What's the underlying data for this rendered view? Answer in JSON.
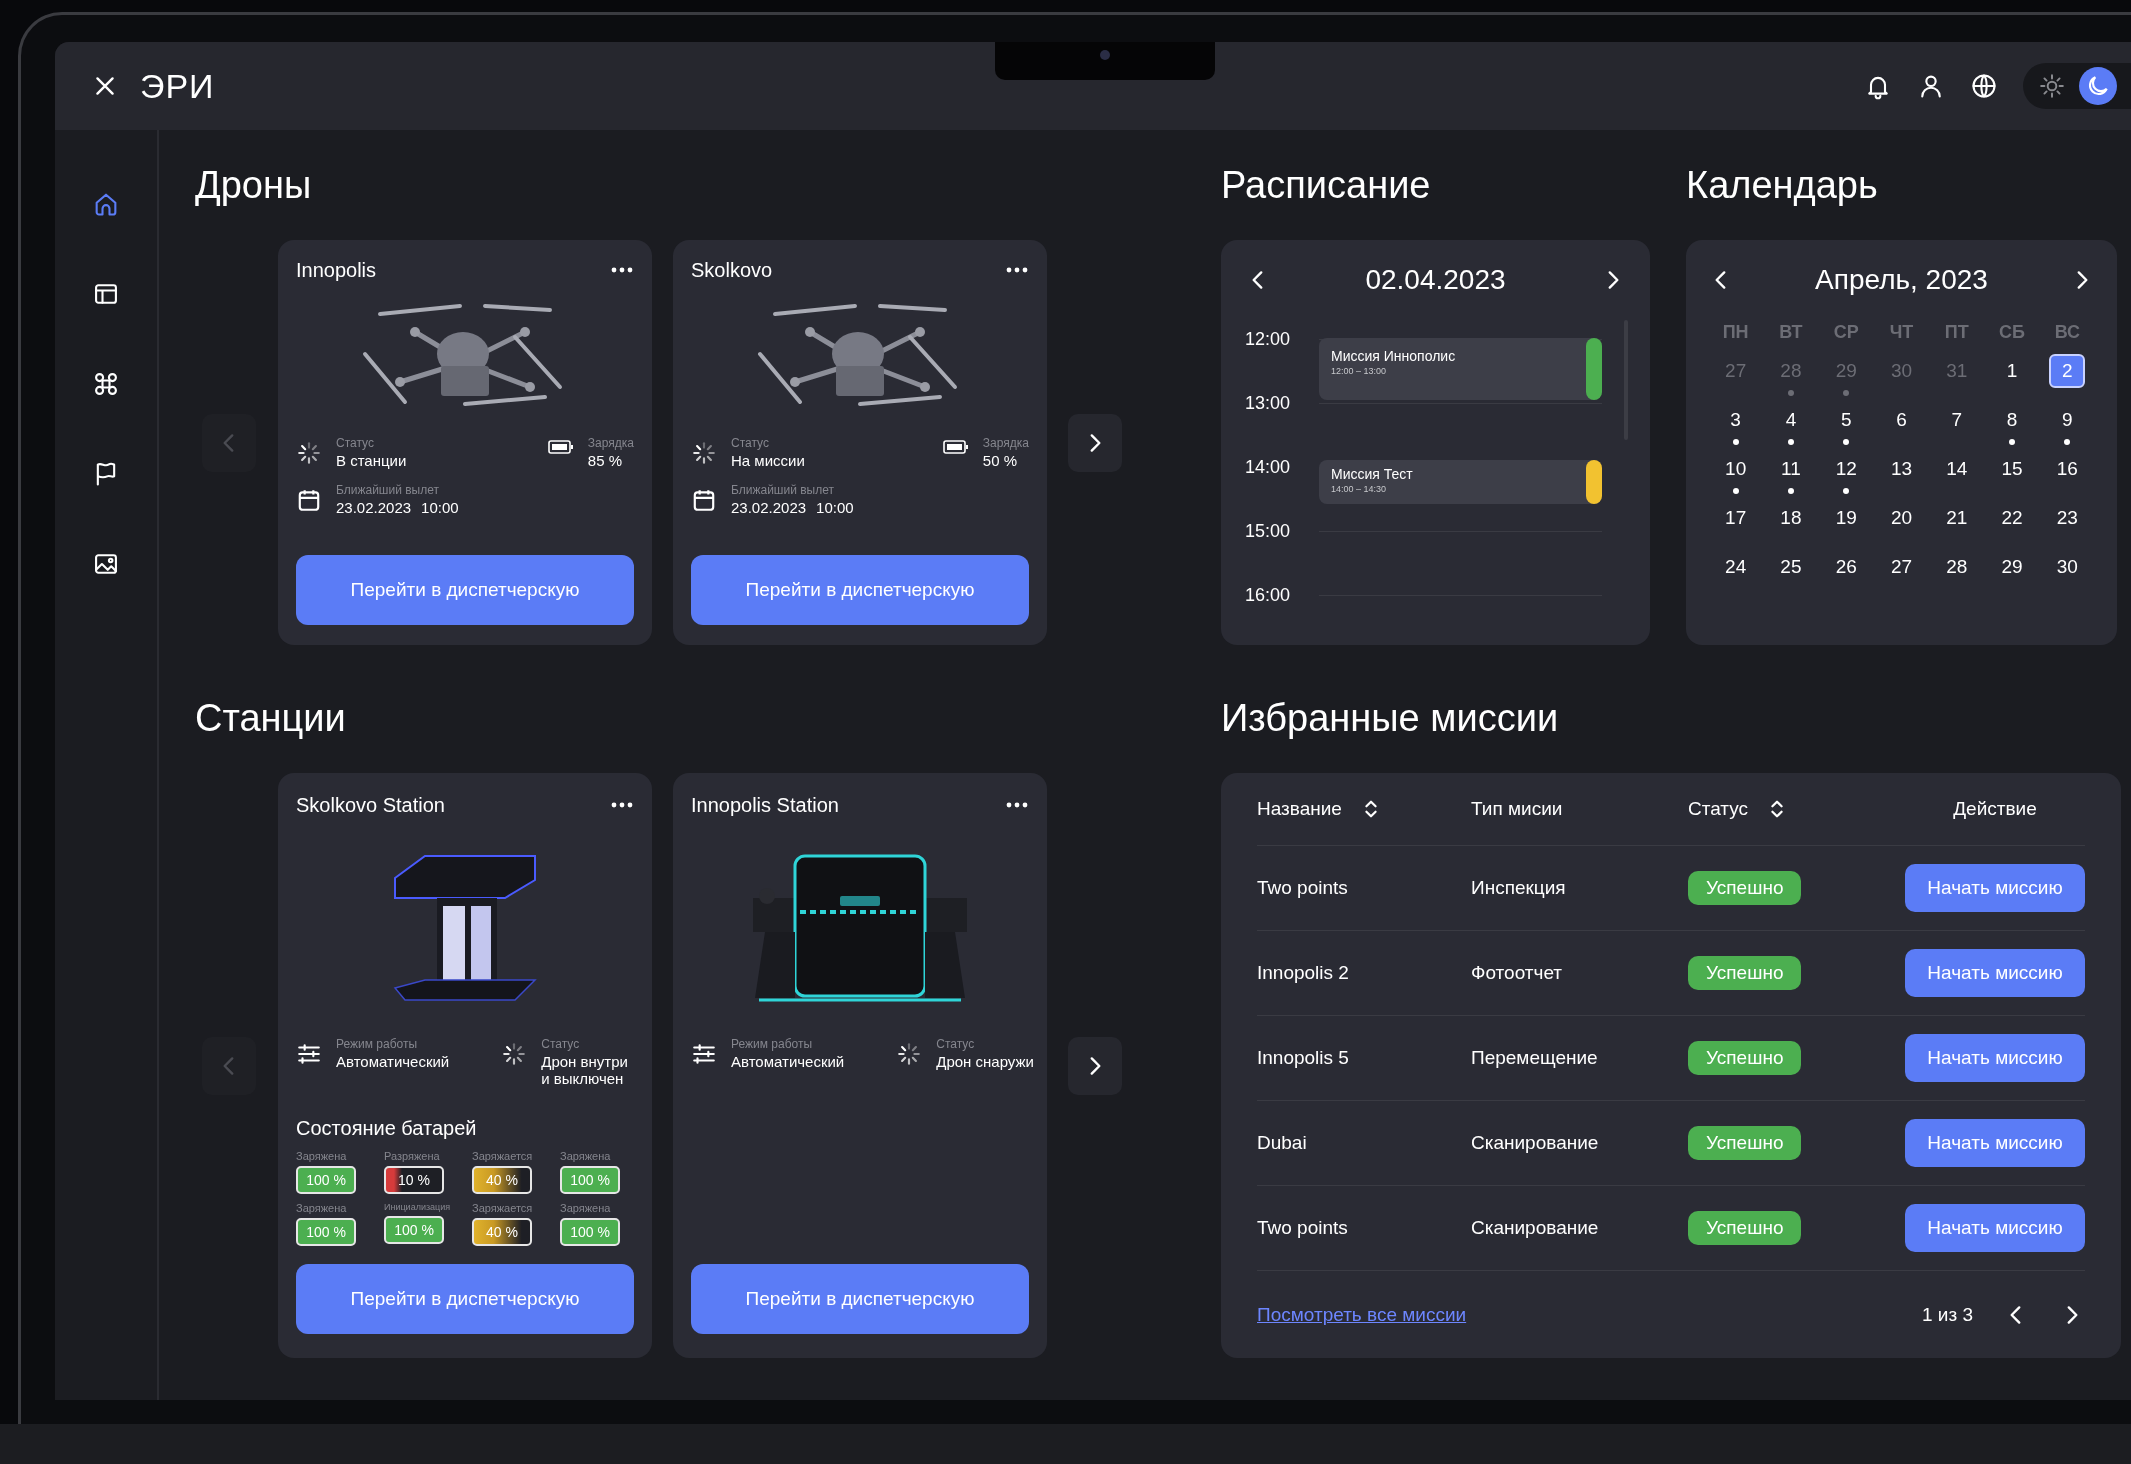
{
  "header": {
    "logo": "ЭРИ",
    "icons": [
      {
        "kind": "bell"
      },
      {
        "kind": "user"
      },
      {
        "kind": "globe"
      }
    ],
    "theme_toggle": {
      "dark": true
    }
  },
  "sidebar": {
    "items": [
      {
        "kind": "home",
        "selected": true
      },
      {
        "kind": "panel",
        "selected": false
      },
      {
        "kind": "drone",
        "selected": false
      },
      {
        "kind": "flag",
        "selected": false
      },
      {
        "kind": "image",
        "selected": false
      }
    ]
  },
  "drones": {
    "title": "Дроны",
    "prev": {
      "disabled": true
    },
    "next": {
      "disabled": false
    },
    "cards": [
      {
        "name": "Innopolis",
        "status_label": "Статус",
        "status": "В станции",
        "charge_label": "Зарядка",
        "charge": "85 %",
        "departure_label": "Ближайший вылет",
        "departure_date": "23.02.2023",
        "departure_time": "10:00",
        "button": "Перейти в диспетчерскую"
      },
      {
        "name": "Skolkovo",
        "status_label": "Статус",
        "status": "На миссии",
        "charge_label": "Зарядка",
        "charge": "50 %",
        "departure_label": "Ближайший вылет",
        "departure_date": "23.02.2023",
        "departure_time": "10:00",
        "button": "Перейти в диспетчерскую"
      }
    ]
  },
  "stations": {
    "title": "Станции",
    "prev": {
      "disabled": true
    },
    "next": {
      "disabled": false
    },
    "cards": [
      {
        "name": "Skolkovo Station",
        "kind": "pillar",
        "mode_label": "Режим работы",
        "mode": "Автоматический",
        "status_label": "Статус",
        "status": "Дрон внутри\nи выключен",
        "batteries": {
          "title": "Состояние батарей",
          "items": [
            {
              "label": "Заряжена",
              "value": "100 %",
              "kind": "full"
            },
            {
              "label": "Разряжена",
              "value": "10 %",
              "kind": "low"
            },
            {
              "label": "Заряжается",
              "value": "40 %",
              "kind": "charging"
            },
            {
              "label": "Заряжена",
              "value": "100 %",
              "kind": "full"
            },
            {
              "label": "Заряжена",
              "value": "100 %",
              "kind": "full"
            },
            {
              "label": "Инициализация",
              "value": "100 %",
              "kind": "full"
            },
            {
              "label": "Заряжается",
              "value": "40 %",
              "kind": "charging"
            },
            {
              "label": "Заряжена",
              "value": "100 %",
              "kind": "full"
            }
          ]
        },
        "button": "Перейти в диспетчерскую"
      },
      {
        "name": "Innopolis Station",
        "kind": "cabinet",
        "mode_label": "Режим работы",
        "mode": "Автоматический",
        "status_label": "Статус",
        "status": "Дрон снаружи",
        "button": "Перейти в диспетчерскую"
      }
    ]
  },
  "schedule": {
    "title": "Расписание",
    "date": "02.04.2023",
    "hours": [
      {
        "time": "12:00",
        "event": {
          "title": "Миссия Иннополис",
          "time": "12:00 – 13:00",
          "kind": "hour",
          "color": "#4caf50"
        }
      },
      {
        "time": "13:00"
      },
      {
        "time": "14:00",
        "event": {
          "title": "Миссия Тест",
          "time": "14:00 – 14:30",
          "kind": "half",
          "color": "#f2c230"
        }
      },
      {
        "time": "15:00"
      },
      {
        "time": "16:00"
      }
    ]
  },
  "calendar": {
    "title": "Календарь",
    "month": "Апрель, 2023",
    "weekdays": [
      "ПН",
      "ВТ",
      "СР",
      "ЧТ",
      "ПТ",
      "СБ",
      "ВС"
    ],
    "days": [
      {
        "day": "27",
        "muted": true,
        "selected": false,
        "has_event": false
      },
      {
        "day": "28",
        "muted": true,
        "selected": false,
        "has_event": true
      },
      {
        "day": "29",
        "muted": true,
        "selected": false,
        "has_event": true
      },
      {
        "day": "30",
        "muted": true,
        "selected": false,
        "has_event": false
      },
      {
        "day": "31",
        "muted": true,
        "selected": false,
        "has_event": false
      },
      {
        "day": "1",
        "muted": false,
        "selected": false,
        "has_event": false
      },
      {
        "day": "2",
        "muted": false,
        "selected": true,
        "has_event": false
      },
      {
        "day": "3",
        "muted": false,
        "selected": false,
        "has_event": true
      },
      {
        "day": "4",
        "muted": false,
        "selected": false,
        "has_event": true
      },
      {
        "day": "5",
        "muted": false,
        "selected": false,
        "has_event": true
      },
      {
        "day": "6",
        "muted": false,
        "selected": false,
        "has_event": false
      },
      {
        "day": "7",
        "muted": false,
        "selected": false,
        "has_event": false
      },
      {
        "day": "8",
        "muted": false,
        "selected": false,
        "has_event": true
      },
      {
        "day": "9",
        "muted": false,
        "selected": false,
        "has_event": true
      },
      {
        "day": "10",
        "muted": false,
        "selected": false,
        "has_event": true
      },
      {
        "day": "11",
        "muted": false,
        "selected": false,
        "has_event": true
      },
      {
        "day": "12",
        "muted": false,
        "selected": false,
        "has_event": true
      },
      {
        "day": "13",
        "muted": false,
        "selected": false,
        "has_event": false
      },
      {
        "day": "14",
        "muted": false,
        "selected": false,
        "has_event": false
      },
      {
        "day": "15",
        "muted": false,
        "selected": false,
        "has_event": false
      },
      {
        "day": "16",
        "muted": false,
        "selected": false,
        "has_event": false
      },
      {
        "day": "17",
        "muted": false,
        "selected": false,
        "has_event": false
      },
      {
        "day": "18",
        "muted": false,
        "selected": false,
        "has_event": false
      },
      {
        "day": "19",
        "muted": false,
        "selected": false,
        "has_event": false
      },
      {
        "day": "20",
        "muted": false,
        "selected": false,
        "has_event": false
      },
      {
        "day": "21",
        "muted": false,
        "selected": false,
        "has_event": false
      },
      {
        "day": "22",
        "muted": false,
        "selected": false,
        "has_event": false
      },
      {
        "day": "23",
        "muted": false,
        "selected": false,
        "has_event": false
      },
      {
        "day": "24",
        "muted": false,
        "selected": false,
        "has_event": false
      },
      {
        "day": "25",
        "muted": false,
        "selected": false,
        "has_event": false
      },
      {
        "day": "26",
        "muted": false,
        "selected": false,
        "has_event": false
      },
      {
        "day": "27",
        "muted": false,
        "selected": false,
        "has_event": false
      },
      {
        "day": "28",
        "muted": false,
        "selected": false,
        "has_event": false
      },
      {
        "day": "29",
        "muted": false,
        "selected": false,
        "has_event": false
      },
      {
        "day": "30",
        "muted": false,
        "selected": false,
        "has_event": false
      }
    ]
  },
  "missions": {
    "title": "Избранные миссии",
    "columns": [
      {
        "label": "Название",
        "sortable": true
      },
      {
        "label": "Тип мисии",
        "sortable": false
      },
      {
        "label": "Статус",
        "sortable": true
      },
      {
        "label": "Действие",
        "sortable": false
      }
    ],
    "rows": [
      {
        "name": "Two points",
        "type": "Инспекция",
        "status": "Успешно",
        "action": "Начать миссию"
      },
      {
        "name": "Innopolis 2",
        "type": "Фотоотчет",
        "status": "Успешно",
        "action": "Начать миссию"
      },
      {
        "name": "Innopolis 5",
        "type": "Перемещение",
        "status": "Успешно",
        "action": "Начать миссию"
      },
      {
        "name": "Dubai",
        "type": "Сканирование",
        "status": "Успешно",
        "action": "Начать миссию"
      },
      {
        "name": "Two points",
        "type": "Сканирование",
        "status": "Успешно",
        "action": "Начать миссию"
      }
    ],
    "footer": {
      "link": "Посмотреть все миссии",
      "page": "1 из 3"
    }
  }
}
